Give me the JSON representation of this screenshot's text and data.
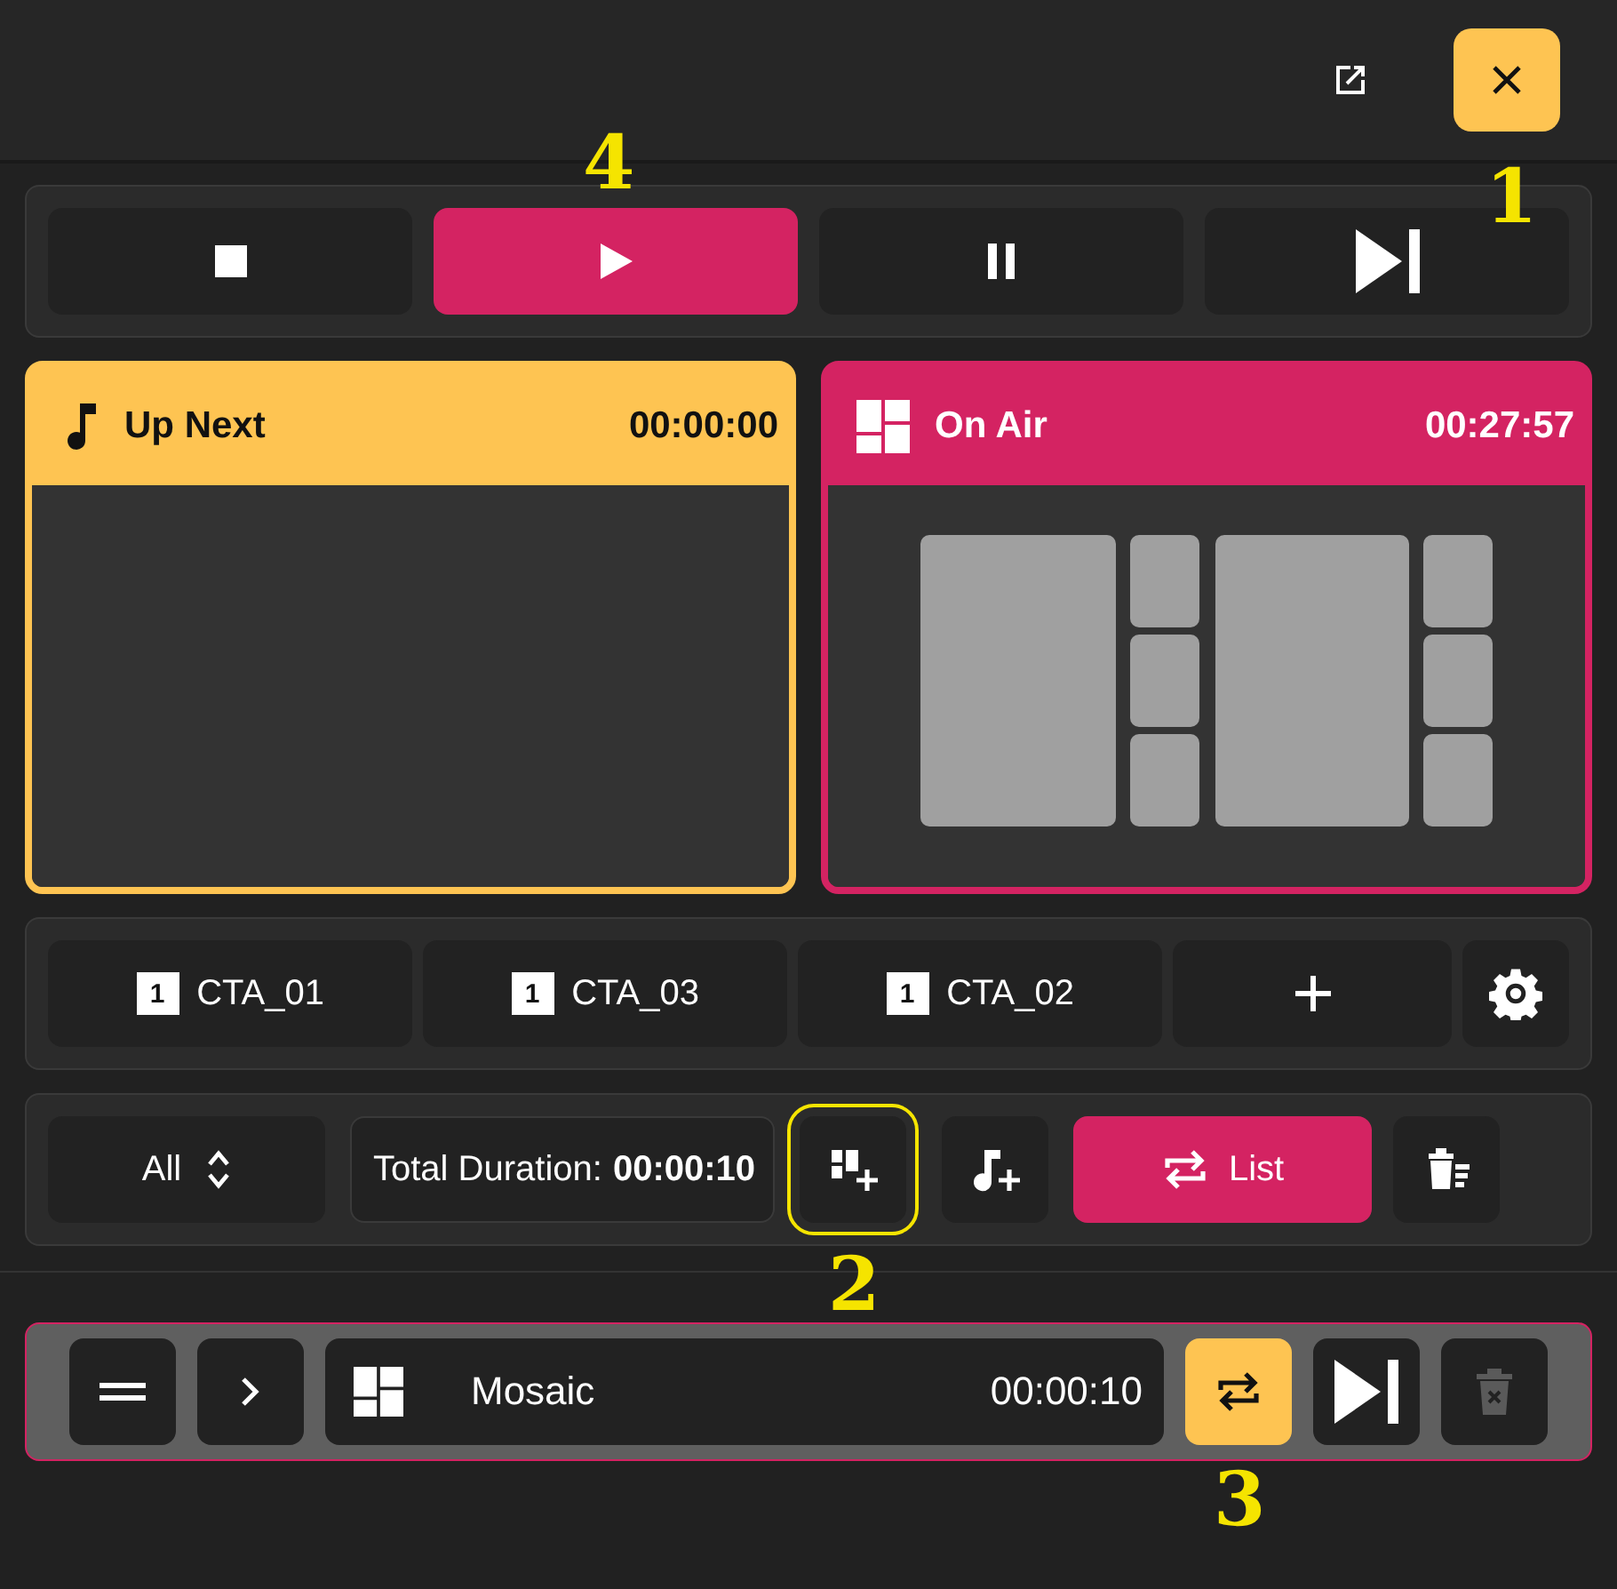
{
  "header": {
    "close_annotation": "1"
  },
  "transport": [
    {
      "kind": "stop",
      "selected": false
    },
    {
      "kind": "play",
      "selected": true,
      "annotation": "4"
    },
    {
      "kind": "pause",
      "selected": false
    },
    {
      "kind": "next",
      "selected": false
    }
  ],
  "up_next": {
    "title": "Up Next",
    "time": "00:00:00"
  },
  "on_air": {
    "title": "On Air",
    "time": "00:27:57"
  },
  "cta_items": [
    {
      "badge": "1",
      "label": "CTA_01"
    },
    {
      "badge": "1",
      "label": "CTA_03"
    },
    {
      "badge": "1",
      "label": "CTA_02"
    }
  ],
  "toolbar": {
    "filter": "All",
    "total_label": "Total Duration:",
    "total_value": "00:00:10",
    "add_layout_annotation": "2",
    "loop_label": "List",
    "loop_on": true
  },
  "playlist": [
    {
      "title": "Mosaic",
      "duration": "00:00:10",
      "loop": true,
      "annotation": "3"
    }
  ]
}
